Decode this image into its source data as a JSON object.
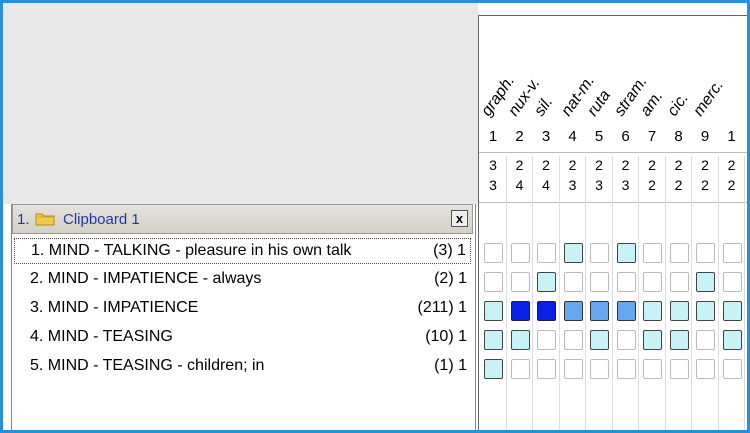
{
  "clipboard": {
    "number": "1.",
    "title": "Clipboard 1",
    "close_label": "x",
    "rubrics": [
      {
        "label": "1. MIND - TALKING - pleasure in his own talk",
        "count": "(3) 1"
      },
      {
        "label": "2. MIND - IMPATIENCE - always",
        "count": "(2) 1"
      },
      {
        "label": "3. MIND - IMPATIENCE",
        "count": "(211) 1"
      },
      {
        "label": "4. MIND - TEASING",
        "count": "(10) 1"
      },
      {
        "label": "5. MIND - TEASING - children; in",
        "count": "(1) 1"
      }
    ]
  },
  "grid": {
    "remedies": [
      "graph.",
      "nux-v.",
      "sil.",
      "nat-m.",
      "ruta",
      "stram.",
      "am.",
      "cic.",
      "merc."
    ],
    "column_numbers": [
      "1",
      "2",
      "3",
      "4",
      "5",
      "6",
      "7",
      "8",
      "9",
      "1"
    ],
    "scores_top": [
      "3",
      "2",
      "2",
      "2",
      "2",
      "2",
      "2",
      "2",
      "2",
      "2"
    ],
    "scores_bottom": [
      "3",
      "4",
      "4",
      "3",
      "3",
      "3",
      "2",
      "2",
      "2",
      "2"
    ],
    "cells": [
      [
        0,
        0,
        0,
        1,
        0,
        1,
        0,
        0,
        0,
        0
      ],
      [
        0,
        0,
        1,
        0,
        0,
        0,
        0,
        0,
        1,
        0
      ],
      [
        1,
        3,
        3,
        2,
        2,
        2,
        1,
        1,
        1,
        1
      ],
      [
        1,
        1,
        0,
        0,
        1,
        0,
        1,
        1,
        0,
        1
      ],
      [
        1,
        0,
        0,
        0,
        0,
        0,
        0,
        0,
        0,
        0
      ]
    ]
  }
}
